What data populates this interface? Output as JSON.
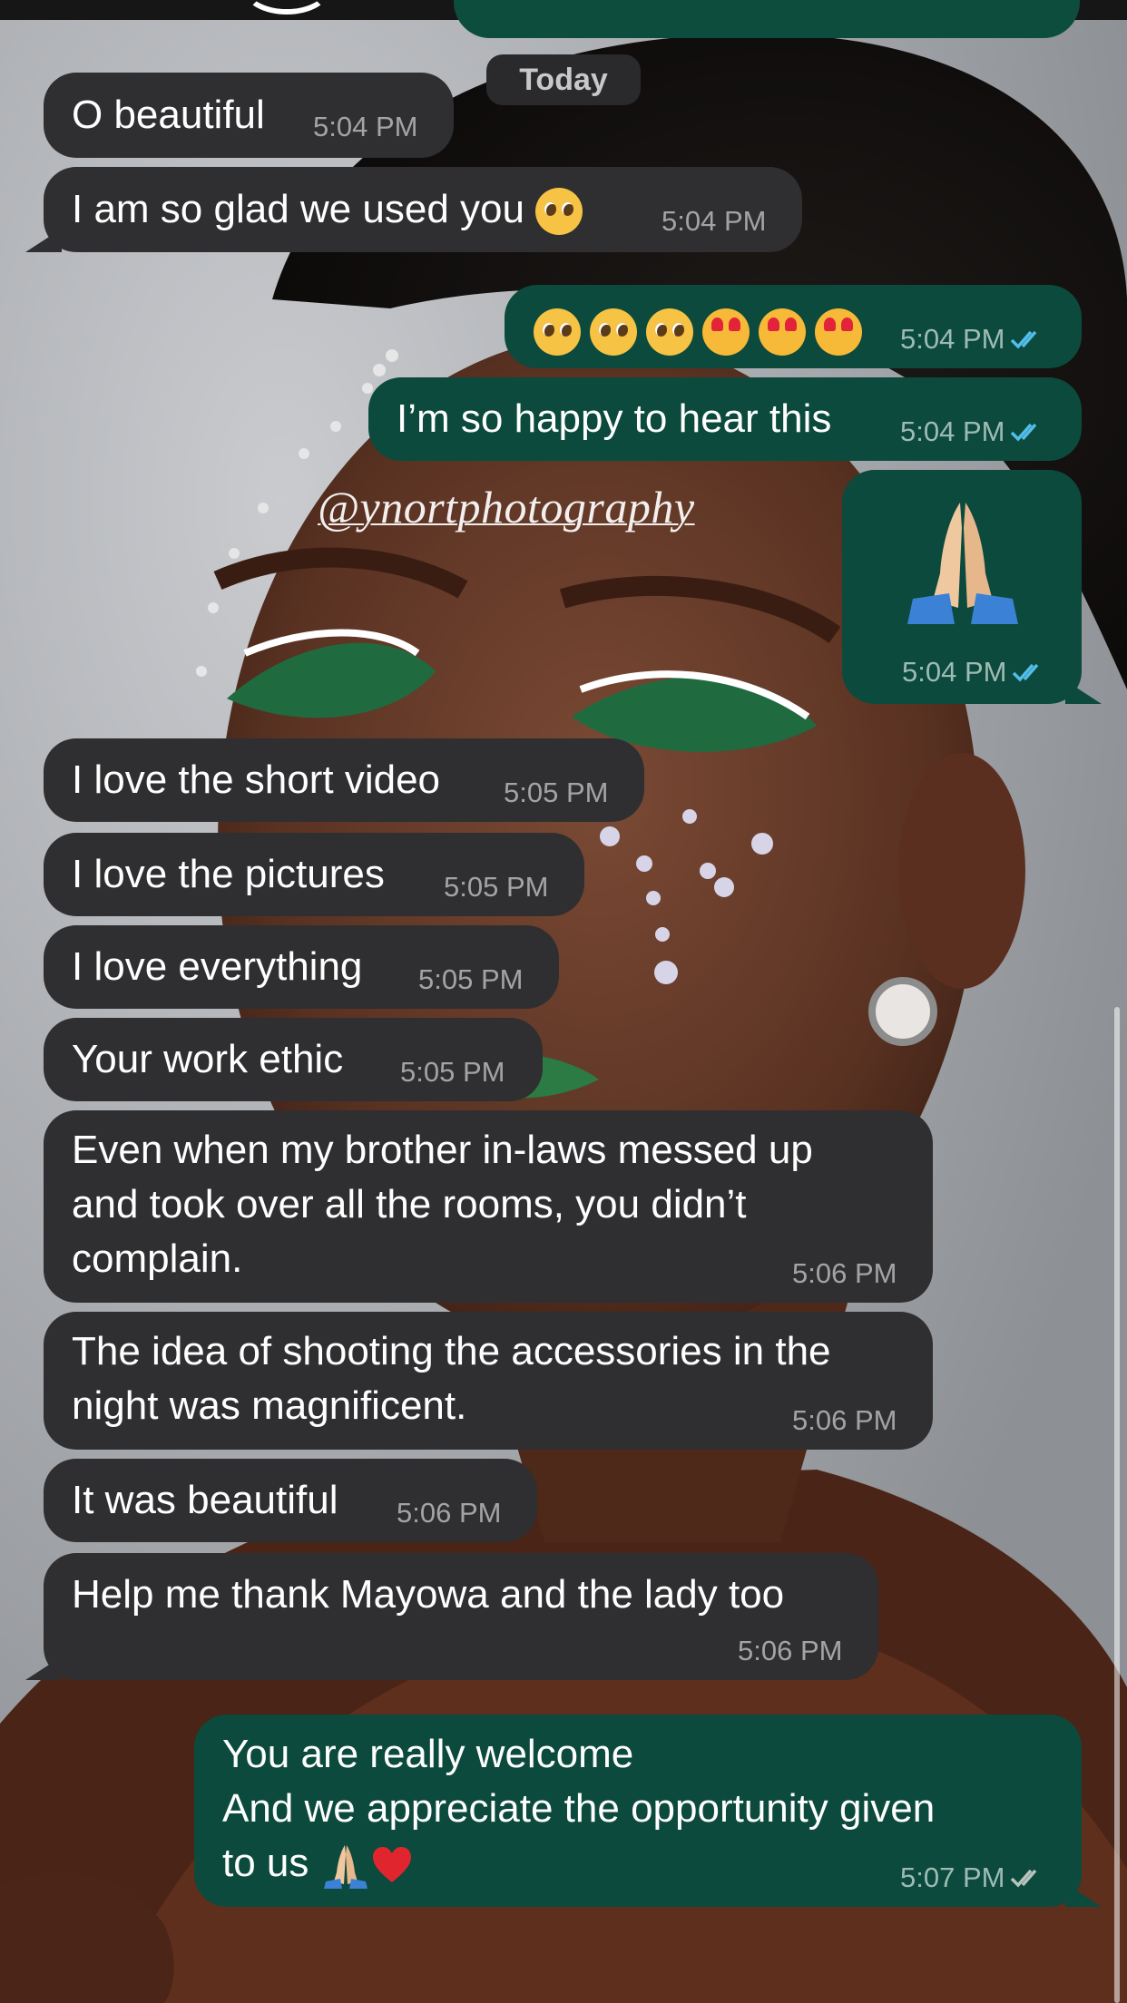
{
  "chat": {
    "date_divider": "Today",
    "watermark": "@ynortphotography",
    "messages": [
      {
        "dir": "in",
        "text": "O beautiful",
        "time": "5:04 PM"
      },
      {
        "dir": "in",
        "text": "I am so glad we used you",
        "emoji": "pleading-face",
        "time": "5:04 PM"
      },
      {
        "dir": "out",
        "emoji": "3x pleading-face, 3x smiling-face-with-hearts",
        "time": "5:04 PM",
        "status": "read"
      },
      {
        "dir": "out",
        "text": "I’m so happy to hear this",
        "time": "5:04 PM",
        "status": "read"
      },
      {
        "dir": "out",
        "emoji": "folded-hands",
        "time": "5:04 PM",
        "status": "read"
      },
      {
        "dir": "in",
        "text": "I love the short video",
        "time": "5:05 PM"
      },
      {
        "dir": "in",
        "text": "I love the pictures",
        "time": "5:05 PM"
      },
      {
        "dir": "in",
        "text": "I love everything",
        "time": "5:05 PM"
      },
      {
        "dir": "in",
        "text": "Your work ethic",
        "time": "5:05 PM"
      },
      {
        "dir": "in",
        "lines": [
          "Even when my brother in-laws messed up",
          "and took over all the rooms, you didn’t",
          "complain."
        ],
        "time": "5:06 PM"
      },
      {
        "dir": "in",
        "lines": [
          "The idea of shooting the accessories in the",
          "night was magnificent."
        ],
        "time": "5:06 PM"
      },
      {
        "dir": "in",
        "text": "It was beautiful",
        "time": "5:06 PM"
      },
      {
        "dir": "in",
        "text": "Help me thank Mayowa and the lady too",
        "time": "5:06 PM"
      },
      {
        "dir": "out",
        "lines": [
          "You are really welcome",
          "And we appreciate the opportunity given",
          "to us"
        ],
        "emoji": "folded-hands, red-heart",
        "time": "5:07 PM",
        "status": "delivered"
      }
    ]
  },
  "colors": {
    "incoming_bubble": "#2f2f31",
    "outgoing_bubble": "#0b4a3c",
    "read_tick": "#53bdeb",
    "delivered_tick": "#b8c4c0"
  }
}
